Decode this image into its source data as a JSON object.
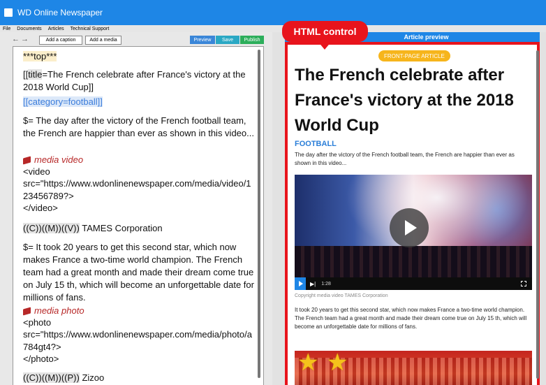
{
  "app": {
    "title": "WD Online Newspaper"
  },
  "menu": {
    "items": [
      "File",
      "Documents",
      "Articles",
      "Technical Support"
    ]
  },
  "toolbar": {
    "back_icon": "arrow-left-icon",
    "forward_icon": "arrow-right-icon",
    "add_caption_label": "Add a caption",
    "add_media_label": "Add a media",
    "preview_label": "Preview",
    "save_label": "Save",
    "publish_label": "Publish"
  },
  "editor": {
    "top_tag": "***top***",
    "title_key": "title",
    "title_value": "=The French celebrate after France's victory at the 2018 World Cup]]",
    "title_prefix": "[[",
    "category_key": "category",
    "category_line": "[[category=football]]",
    "intro": "$= The day after the victory of the French football team, the French are happier than ever as shown in this video...",
    "media_video_label": "media video",
    "video_open": "<video",
    "video_src": "src=\"https://www.wdonlinenewspaper.com/media/video/123456789?>",
    "video_close": "</video>",
    "video_credit_tag": "((C))((M))((V))",
    "video_credit_name": " TAMES Corporation",
    "body": "$= It took 20 years to get this second star, which now makes France a two-time world champion. The French team had a great month and made their dream come true on July 15 th, which will become an unforgettable date for millions of fans.",
    "media_photo_label": "media photo",
    "photo_open": "<photo",
    "photo_src": "src=\"https://www.wdonlinenewspaper.com/media/photo/a784gt4?>",
    "photo_close": "</photo>",
    "photo_credit_tag": "((C))((M))((P))",
    "photo_credit_name": " Zizoo"
  },
  "callout": {
    "label": "HTML control"
  },
  "preview": {
    "header": "Article preview",
    "badge": "FRONT-PAGE ARTICLE",
    "title": "The French celebrate after France's victory at the 2018 World Cup",
    "category": "FOOTBALL",
    "intro": "The day after the victory of the French football team, the French are happier than ever as shown in this video...",
    "video_time": "1:28",
    "video_caption": "Copyright media video TAMES Corporation",
    "body": "It took 20 years to get this second star, which now makes France a two-time world champion. The French team had a great month and made their dream come true on July 15 th, which will become an unforgettable date for millions of fans."
  },
  "colors": {
    "title_bar": "#1e86e6",
    "callout_red": "#e8141c",
    "badge_yellow": "#f6b51c",
    "preview_button": "#3a86d8",
    "save_button": "#2aa8c4",
    "publish_button": "#2cae5b",
    "media_label": "#b72828"
  }
}
